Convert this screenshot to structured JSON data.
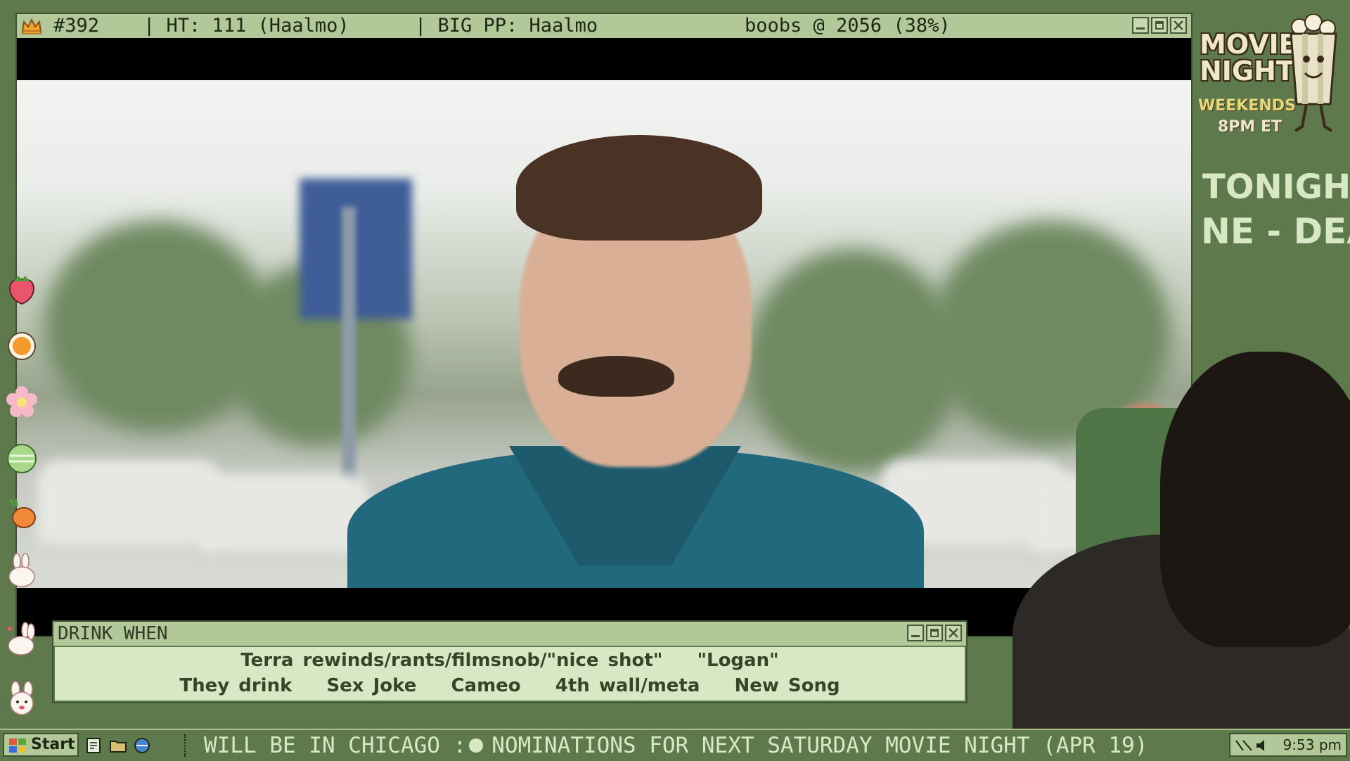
{
  "window": {
    "counter": "#392",
    "ht": "| HT: 111 (Haalmo)",
    "bigpp": "| BIG PP: Haalmo",
    "status": "boobs @ 2056 (38%)"
  },
  "drink_panel": {
    "title": "DRINK WHEN",
    "row1": [
      "Terra rewinds/rants/filmsnob/\"nice shot\"",
      "\"Logan\""
    ],
    "row2": [
      "They drink",
      "Sex Joke",
      "Cameo",
      "4th wall/meta",
      "New Song"
    ]
  },
  "logo": {
    "line1": "MOVIE",
    "line2": "NIGHT",
    "sub1": "WEEKENDS",
    "sub2": "8PM ET"
  },
  "side": {
    "tonight": "TONIGHT:",
    "marquee": "NE - DEA"
  },
  "taskbar": {
    "start_label": "Start",
    "ticker": "WILL BE IN CHICAGO :",
    "ticker2": "NOMINATIONS FOR NEXT SATURDAY MOVIE NIGHT (APR 19)",
    "clock": "9:53 pm"
  },
  "icons": {
    "title_left": "crown-icon",
    "stickers": [
      "strawberry-icon",
      "orange-icon",
      "flower-icon",
      "melon-icon",
      "carrot-icon",
      "bunny-icon",
      "bunny-icon",
      "bunny-face-icon"
    ]
  },
  "colors": {
    "bezel": "#5e7a4c",
    "titlebar": "#b3c898",
    "panel": "#d9e8c4",
    "text_dark": "#1c2815"
  }
}
